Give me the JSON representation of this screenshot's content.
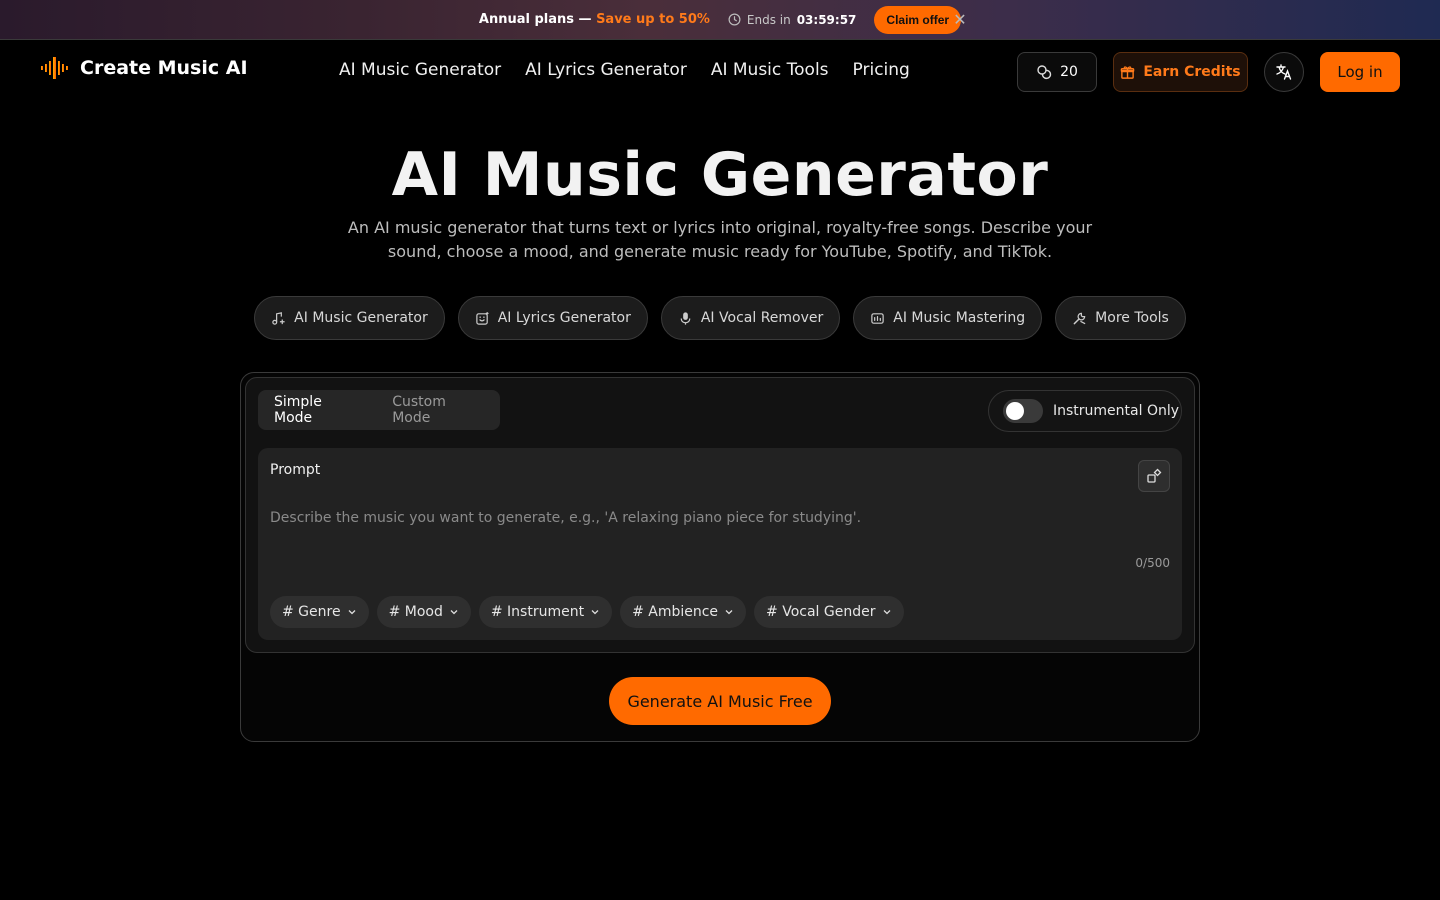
{
  "banner": {
    "title_prefix": "Annual plans — ",
    "title_accent": "Save up to 50%",
    "ends_label": "Ends in",
    "countdown": "03:59:57",
    "claim_label": "Claim offer",
    "close_glyph": "✕"
  },
  "header": {
    "brand": "Create Music AI",
    "nav": [
      "AI Music Generator",
      "AI Lyrics Generator",
      "AI Music Tools",
      "Pricing"
    ],
    "credits": "20",
    "earn_label": "Earn Credits",
    "login_label": "Log in",
    "accent_color": "#ff6a00"
  },
  "hero": {
    "title": "AI Music Generator",
    "subtitle": "An AI music generator that turns text or lyrics into original, royalty-free songs. Describe your sound, choose a mood, and generate music ready for YouTube, Spotify, and TikTok."
  },
  "tools": [
    {
      "label": "AI Music Generator",
      "icon": "music-sparkle-icon"
    },
    {
      "label": "AI Lyrics Generator",
      "icon": "lyrics-sparkle-icon"
    },
    {
      "label": "AI Vocal Remover",
      "icon": "microphone-icon"
    },
    {
      "label": "AI Music Mastering",
      "icon": "mastering-icon"
    },
    {
      "label": "More Tools",
      "icon": "tools-icon"
    }
  ],
  "generator": {
    "modes": [
      "Simple Mode",
      "Custom Mode"
    ],
    "active_mode": "Simple Mode",
    "instrumental_label": "Instrumental Only",
    "instrumental_on": false,
    "prompt_label": "Prompt",
    "prompt_placeholder": "Describe the music you want to generate, e.g., 'A relaxing piano piece for studying'.",
    "char_count": "0/500",
    "tags": [
      "# Genre",
      "# Mood",
      "# Instrument",
      "# Ambience",
      "# Vocal Gender"
    ],
    "generate_label": "Generate AI Music Free"
  }
}
